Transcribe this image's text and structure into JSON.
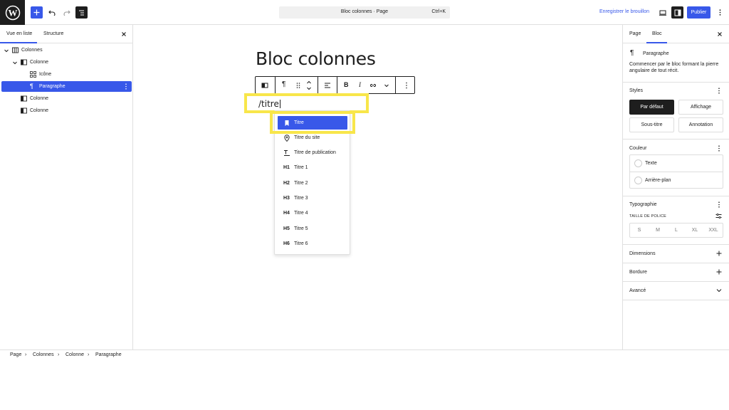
{
  "topbar": {
    "command_title": "Bloc colonnes · Page",
    "command_shortcut": "Ctrl+K",
    "save_draft_label": "Enregistrer le brouillon",
    "publish_label": "Publier",
    "icons": [
      "wordpress-logo",
      "plus-icon",
      "undo-icon",
      "redo-icon",
      "document-overview-icon",
      "desktop-preview-icon",
      "settings-sidebar-icon",
      "kebab-menu-icon"
    ]
  },
  "left_panel": {
    "tabs": [
      {
        "label": "Vue en liste",
        "active": true
      },
      {
        "label": "Structure",
        "active": false
      }
    ],
    "tree": [
      {
        "label": "Colonnes",
        "icon": "columns-icon",
        "expanded": true,
        "level": 1
      },
      {
        "label": "Colonne",
        "icon": "column-icon",
        "expanded": true,
        "level": 2
      },
      {
        "label": "Icône",
        "icon": "icon-block-icon",
        "level": 3
      },
      {
        "label": "Paragraphe",
        "icon": "paragraph-icon",
        "level": 3,
        "selected": true
      },
      {
        "label": "Colonne",
        "icon": "column-icon",
        "level": 2
      },
      {
        "label": "Colonne",
        "icon": "column-icon",
        "level": 2
      }
    ]
  },
  "canvas": {
    "page_title": "Bloc colonnes",
    "editing_text": "/titre",
    "toolbar_icons": [
      "columns-parent-icon",
      "paragraph-icon",
      "drag-handle-icon",
      "move-up-down-icon",
      "align-icon",
      "bold-icon",
      "italic-icon",
      "link-icon",
      "more-chevron-icon",
      "options-kebab-icon"
    ],
    "autocomplete": [
      {
        "label": "Titre",
        "icon": "bookmark",
        "active": true
      },
      {
        "label": "Titre du site",
        "icon": "map-pin"
      },
      {
        "label": "Titre de publication",
        "icon": "post-title"
      },
      {
        "label": "Titre 1",
        "icon": "H1"
      },
      {
        "label": "Titre 2",
        "icon": "H2"
      },
      {
        "label": "Titre 3",
        "icon": "H3"
      },
      {
        "label": "Titre 4",
        "icon": "H4"
      },
      {
        "label": "Titre 5",
        "icon": "H5"
      },
      {
        "label": "Titre 6",
        "icon": "H6"
      }
    ],
    "highlight_color": "#f8e64a"
  },
  "right_panel": {
    "tabs": [
      {
        "label": "Page",
        "active": false
      },
      {
        "label": "Bloc",
        "active": true
      }
    ],
    "block_title": "Paragraphe",
    "block_description": "Commencer par le bloc formant la pierre angulaire de tout récit.",
    "styles": {
      "title": "Styles",
      "options": [
        {
          "label": "Par défaut",
          "active": true
        },
        {
          "label": "Affichage"
        },
        {
          "label": "Sous-titre"
        },
        {
          "label": "Annotation"
        }
      ]
    },
    "color": {
      "title": "Couleur",
      "items": [
        "Texte",
        "Arrière-plan"
      ]
    },
    "typography": {
      "title": "Typographie",
      "size_label": "TAILLE DE POLICE",
      "sizes": [
        "S",
        "M",
        "L",
        "XL",
        "XXL"
      ]
    },
    "dimensions": "Dimensions",
    "border": "Bordure",
    "advanced": "Avancé"
  },
  "breadcrumb": [
    "Page",
    "Colonnes",
    "Colonne",
    "Paragraphe"
  ],
  "accent_color": "#3858e9"
}
